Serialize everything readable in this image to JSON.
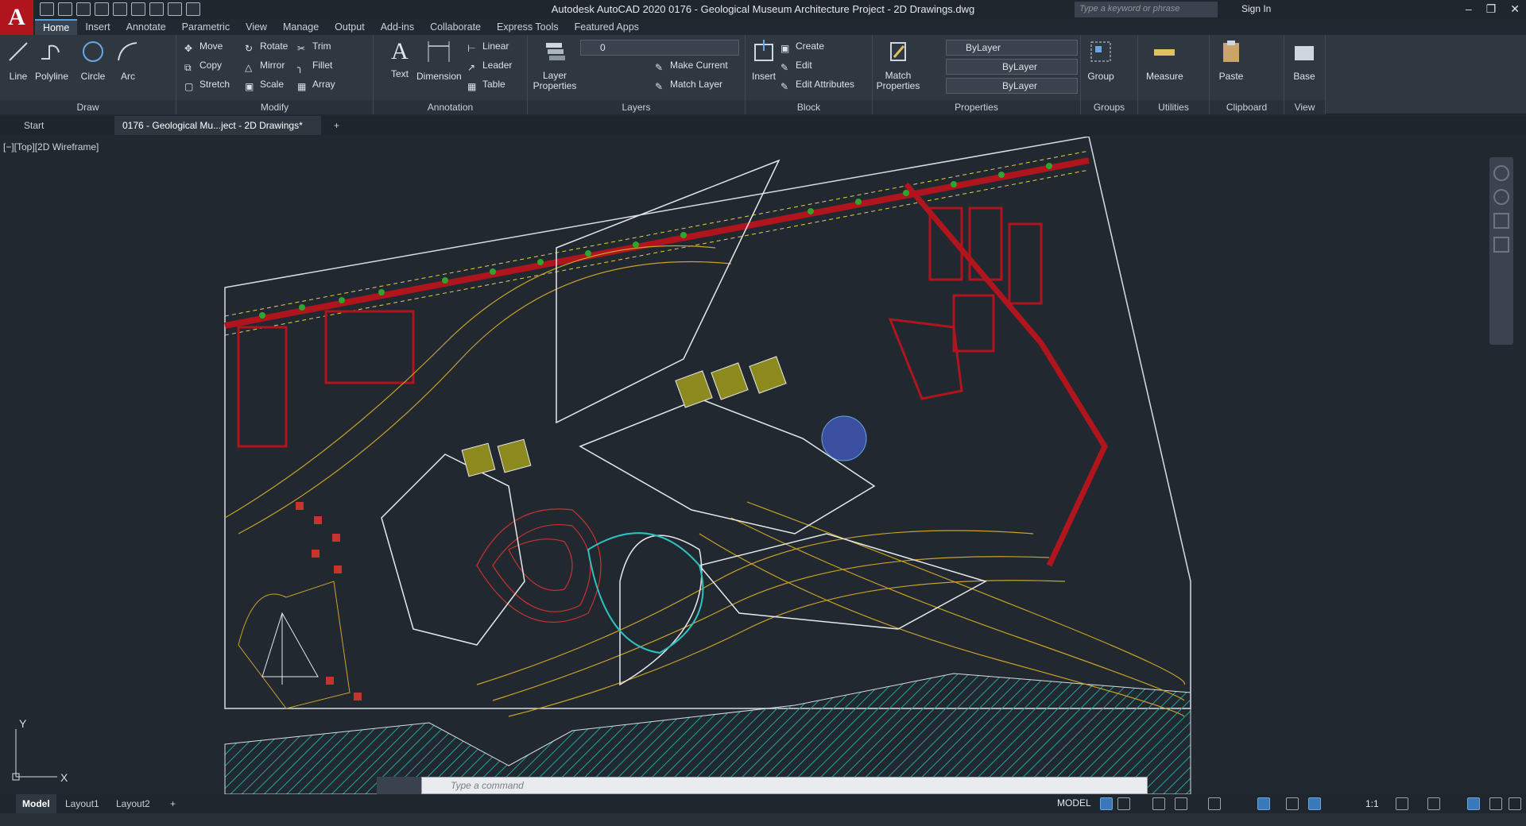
{
  "window": {
    "title": "Autodesk AutoCAD 2020    0176 - Geological Museum Architecture Project - 2D Drawings.dwg",
    "search_placeholder": "Type a keyword or phrase",
    "sign_in": "Sign In"
  },
  "menu": {
    "tabs": [
      "Home",
      "Insert",
      "Annotate",
      "Parametric",
      "View",
      "Manage",
      "Output",
      "Add-ins",
      "Collaborate",
      "Express Tools",
      "Featured Apps"
    ]
  },
  "ribbon": {
    "draw": {
      "title": "Draw",
      "line": "Line",
      "polyline": "Polyline",
      "circle": "Circle",
      "arc": "Arc"
    },
    "modify": {
      "title": "Modify",
      "move": "Move",
      "rotate": "Rotate",
      "trim": "Trim",
      "copy": "Copy",
      "mirror": "Mirror",
      "fillet": "Fillet",
      "stretch": "Stretch",
      "scale": "Scale",
      "array": "Array"
    },
    "annotation": {
      "title": "Annotation",
      "text": "Text",
      "dimension": "Dimension",
      "linear": "Linear",
      "leader": "Leader",
      "table": "Table"
    },
    "layers": {
      "title": "Layers",
      "layer_properties": "Layer Properties",
      "current_layer": "0",
      "make_current": "Make Current",
      "match_layer": "Match Layer"
    },
    "block": {
      "title": "Block",
      "insert": "Insert",
      "create": "Create",
      "edit": "Edit",
      "edit_attributes": "Edit Attributes"
    },
    "properties": {
      "title": "Properties",
      "match_properties": "Match Properties",
      "color": "ByLayer",
      "linetype": "ByLayer",
      "lineweight": "ByLayer"
    },
    "groups": {
      "title": "Groups",
      "group": "Group"
    },
    "utilities": {
      "title": "Utilities",
      "measure": "Measure"
    },
    "clipboard": {
      "title": "Clipboard",
      "paste": "Paste"
    },
    "view": {
      "title": "View",
      "base": "Base"
    }
  },
  "doc_tabs": {
    "start": "Start",
    "active": "0176 - Geological Mu...ject - 2D Drawings*"
  },
  "viewport": {
    "label": "[−][Top][2D Wireframe]"
  },
  "command": {
    "placeholder": "Type a command"
  },
  "status": {
    "layouts": [
      "Model",
      "Layout1",
      "Layout2"
    ],
    "model": "MODEL",
    "scale": "1:1"
  },
  "colors": {
    "ribbon": "#2f3841",
    "canvas": "#212830",
    "accent": "#3b78b8",
    "road_red": "#b0141d",
    "contour_yellow": "#c9a227",
    "water_cyan": "#1fa4a0"
  }
}
